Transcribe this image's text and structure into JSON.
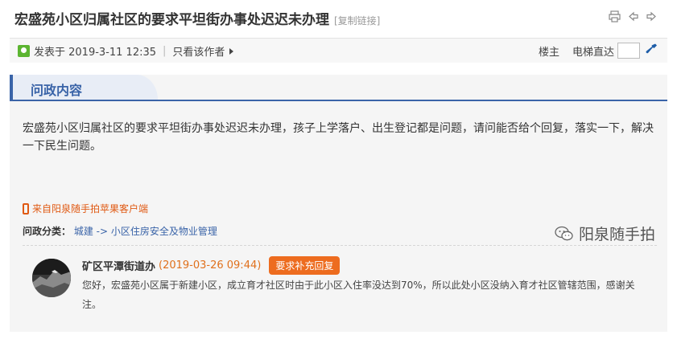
{
  "header": {
    "title": "宏盛苑小区归属社区的要求平坦街办事处迟迟未办理",
    "copy_link": "[复制链接]",
    "icons": [
      "print-icon",
      "prev-icon",
      "next-icon"
    ]
  },
  "meta": {
    "posted": "发表于 2019-3-11 12:35",
    "sep": "|",
    "only_author": "只看该作者",
    "owner_label": "楼主",
    "elevator_label": "电梯直达"
  },
  "section": {
    "tab_label": "问政内容"
  },
  "post": {
    "content": "宏盛苑小区归属社区的要求平坦街办事处迟迟未办理，孩子上学落户、出生登记都是问题，请问能否给个回复，落实一下，解决一下民生问题。",
    "source": "来自阳泉随手拍苹果客户端",
    "category_key": "问政分类：",
    "category_value": "城建 -> 小区住房安全及物业管理"
  },
  "reply": {
    "name": "矿区平潭街道办",
    "time": "(2019-03-26 09:44)",
    "button": "要求补充回复",
    "text": "您好，宏盛苑小区属于新建小区，成立育才社区时由于此小区入住率没达到70%，所以此处小区没纳入育才社区管辖范围，感谢关注。"
  },
  "watermark": {
    "text": "阳泉随手拍"
  },
  "colors": {
    "accent": "#3a64a8",
    "orange": "#ed6c1f",
    "source_orange": "#e05a14"
  }
}
